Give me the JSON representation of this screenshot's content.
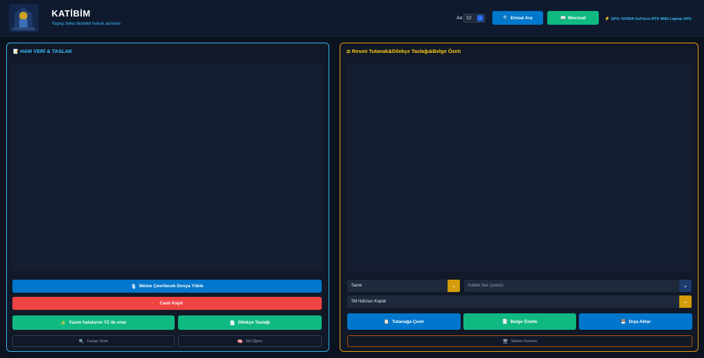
{
  "header": {
    "app_title": "KATİBİM",
    "subtitle": "Yapay zeka destekli hukuk asistanı",
    "fontsize_label": "Aa",
    "fontsize_value": "12",
    "emsal_button": "Emsal Ara",
    "mevzuat_button": "Mevzuat",
    "gpu_info": "GPU: NVIDIA GeForce RTX 4060 Laptop GPU"
  },
  "left_panel": {
    "title": "HAM VERİ & TASLAK",
    "upload_button": "Metne Çevrilecek Dosya Yükle",
    "live_record_button": "Canlı Kayıt",
    "fix_typos_button": "Yazım hatalarını YZ ile onar",
    "petition_draft_button": "Dilekçe Taslağı",
    "hide_fillers_button": "Fazları Gizle",
    "style_learn_button": "Stil Öğren"
  },
  "right_panel": {
    "title": "Resmi Tutanak&Dilekçe Taslağı&Belge Özeti",
    "role_select": "Sanık",
    "quality_select": "Kaliteli Ses Çevirici",
    "style_memory_select": "Stil Hafızası Kapalı",
    "convert_minutes_button": "Tutanağa Çevir",
    "summarize_button": "Belge Özetle",
    "export_button": "Dışa Aktar",
    "system_status_button": "Sistem Durumu"
  },
  "colors": {
    "accent_blue": "#0077cc",
    "accent_green": "#10b981",
    "accent_red": "#ef4444",
    "accent_amber": "#f59e0b",
    "accent_cyan": "#38bdf8"
  }
}
